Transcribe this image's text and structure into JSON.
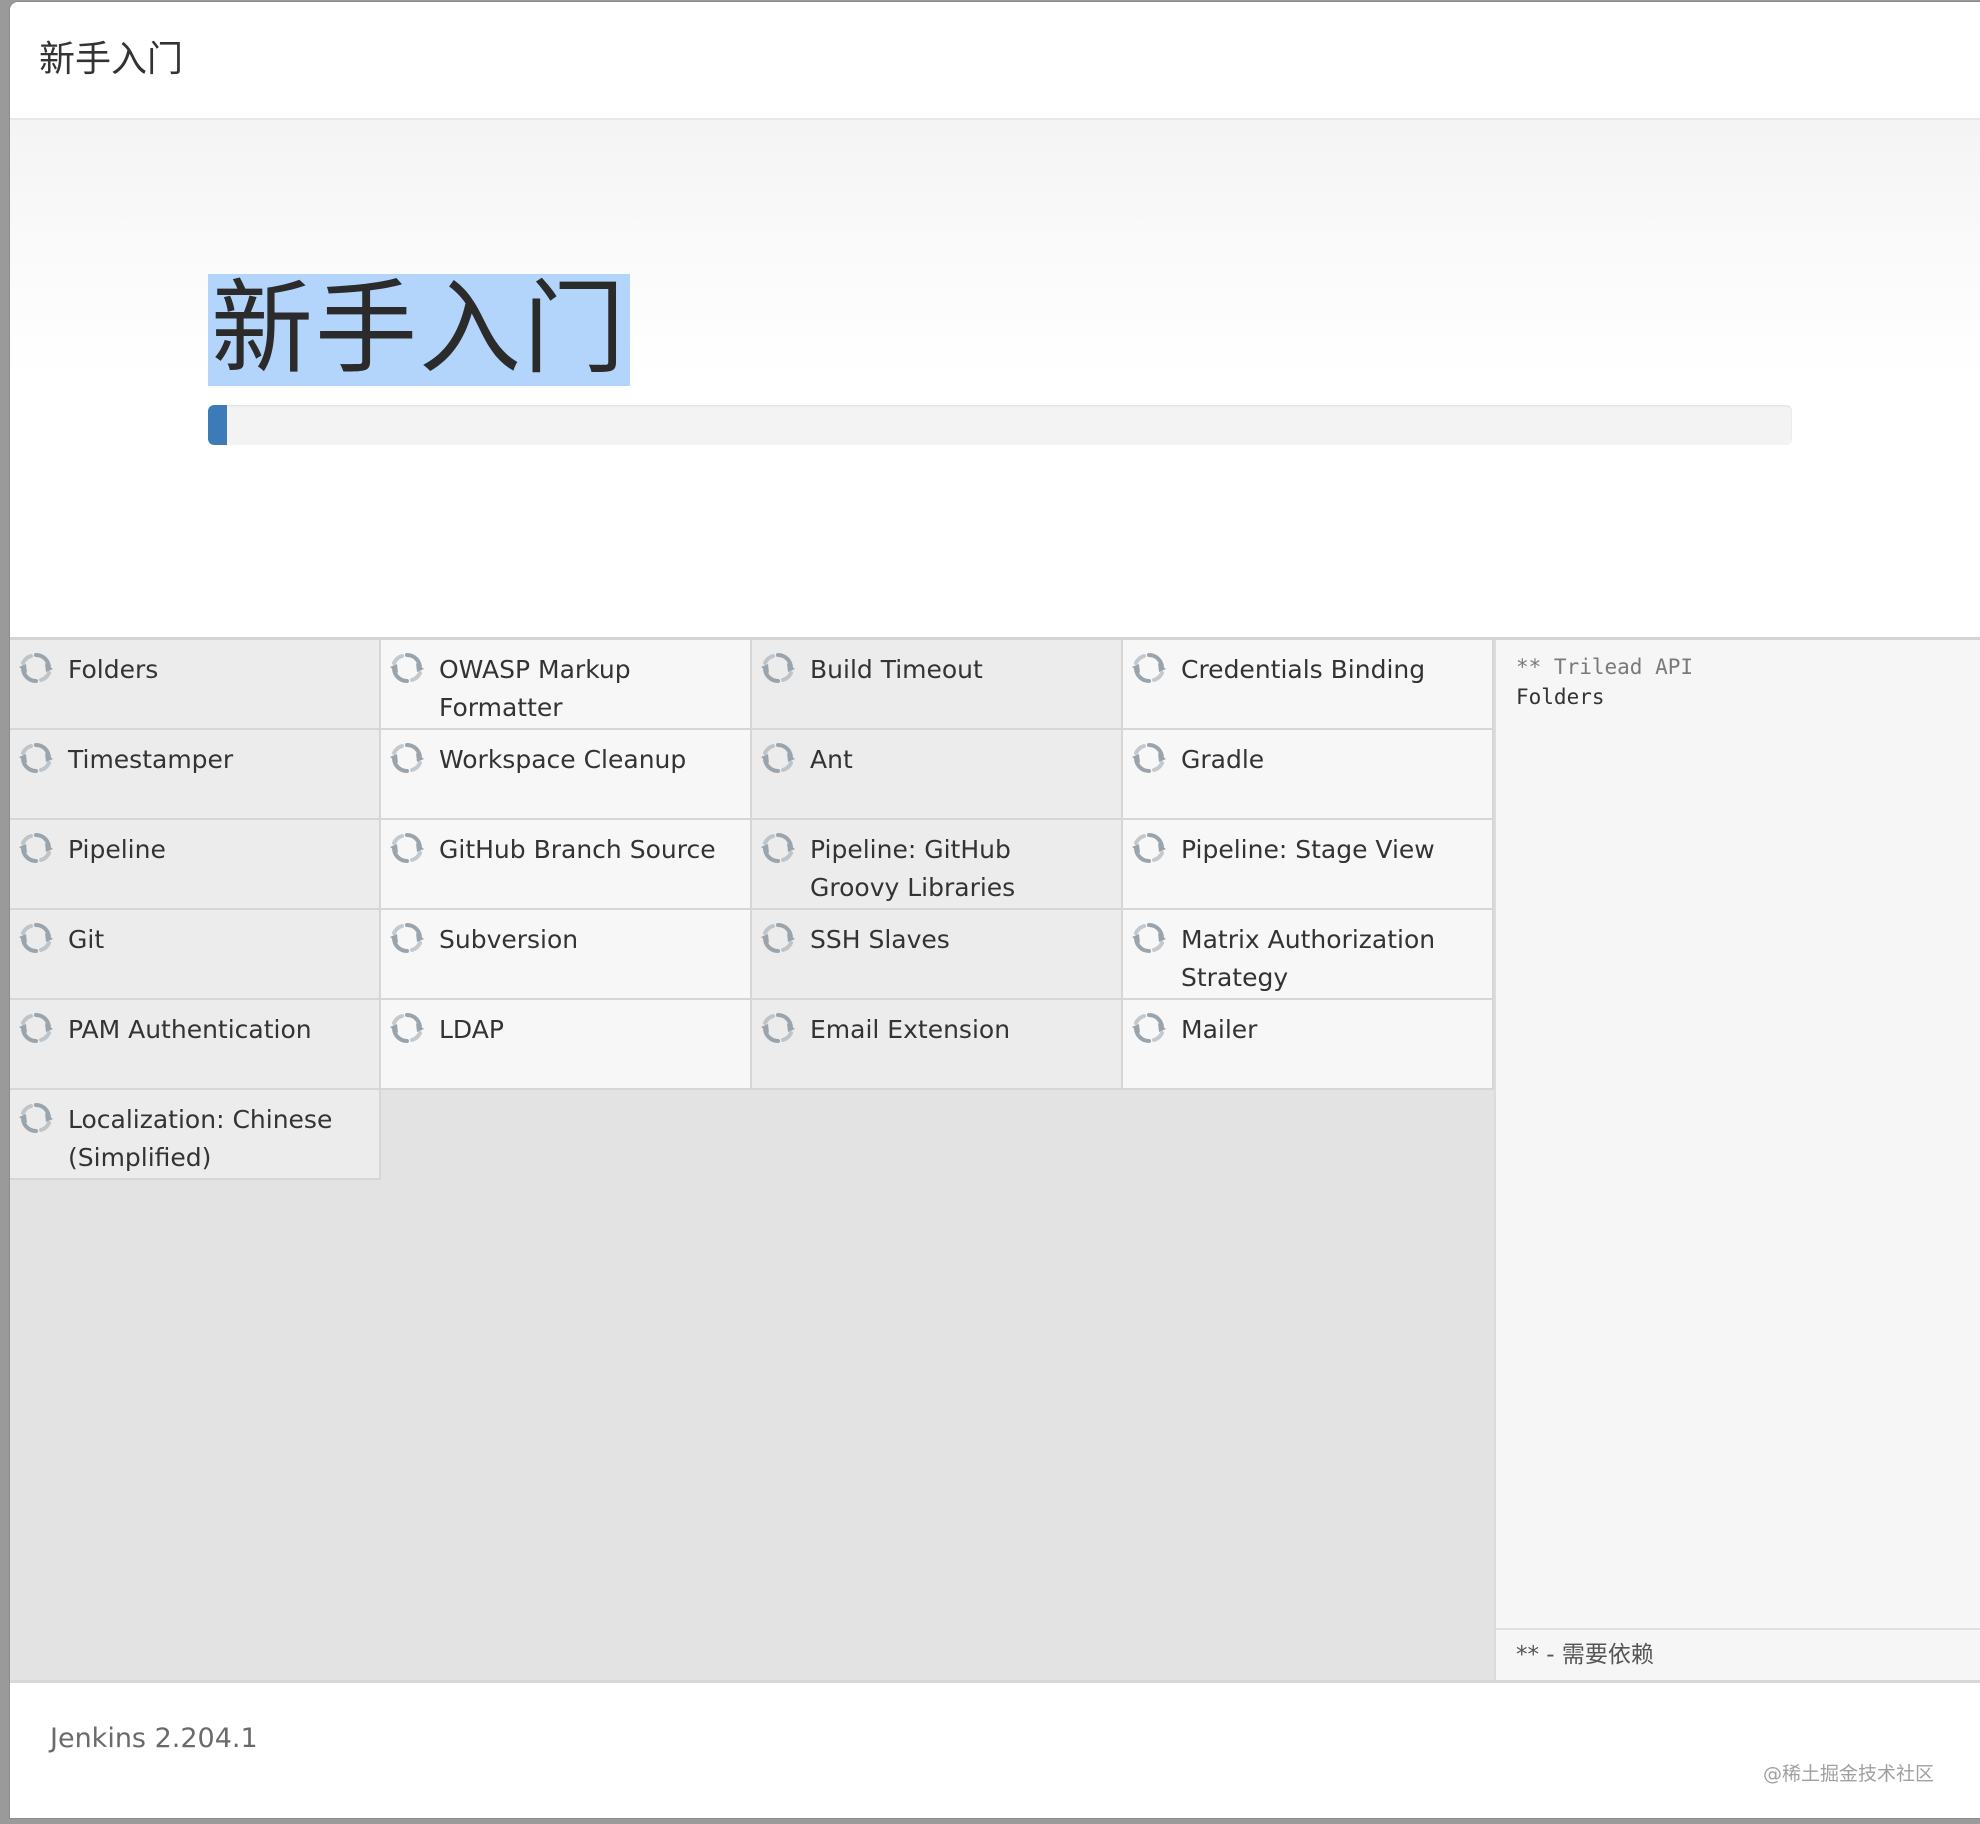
{
  "window": {
    "header_title": "新手入门"
  },
  "hero": {
    "title": "新手入门",
    "progress_percent": 1.2
  },
  "plugins": [
    {
      "name": "Folders"
    },
    {
      "name": "OWASP Markup Formatter"
    },
    {
      "name": "Build Timeout"
    },
    {
      "name": "Credentials Binding"
    },
    {
      "name": "Timestamper"
    },
    {
      "name": "Workspace Cleanup"
    },
    {
      "name": "Ant"
    },
    {
      "name": "Gradle"
    },
    {
      "name": "Pipeline"
    },
    {
      "name": "GitHub Branch Source"
    },
    {
      "name": "Pipeline: GitHub Groovy Libraries"
    },
    {
      "name": "Pipeline: Stage View"
    },
    {
      "name": "Git"
    },
    {
      "name": "Subversion"
    },
    {
      "name": "SSH Slaves"
    },
    {
      "name": "Matrix Authorization Strategy"
    },
    {
      "name": "PAM Authentication"
    },
    {
      "name": "LDAP"
    },
    {
      "name": "Email Extension"
    },
    {
      "name": "Mailer"
    },
    {
      "name": "Localization: Chinese (Simplified)"
    }
  ],
  "plugin_icon": "refresh-icon",
  "log": {
    "line1": "** Trilead API",
    "line2": "Folders",
    "footer_note": "** - 需要依赖"
  },
  "footer": {
    "version": "Jenkins 2.204.1",
    "watermark": "@稀土掘金技术社区"
  },
  "colors": {
    "progress_fill": "#3c7ab8",
    "selection_highlight": "#b3d5fc",
    "icon_gray": "#9aa4ad"
  }
}
